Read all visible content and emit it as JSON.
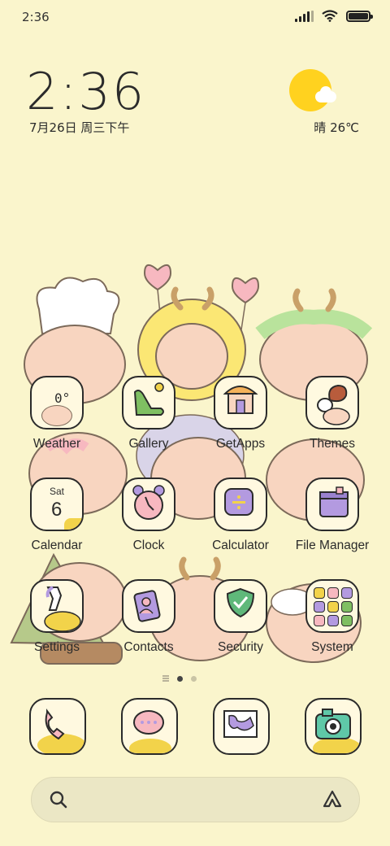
{
  "status_bar": {
    "time": "2:36",
    "signal_icon": "signal-icon",
    "wifi_icon": "wifi-icon",
    "battery_icon": "battery-icon"
  },
  "clock_widget": {
    "time": "2:36",
    "date": "7月26日 周三下午"
  },
  "weather_widget": {
    "condition_icon": "sunny-cloud-icon",
    "text": "晴 26℃"
  },
  "apps": [
    {
      "name": "Weather",
      "icon": "weather-icon",
      "icon_text": "0°"
    },
    {
      "name": "Gallery",
      "icon": "gallery-icon"
    },
    {
      "name": "GetApps",
      "icon": "getapps-icon"
    },
    {
      "name": "Themes",
      "icon": "themes-icon"
    },
    {
      "name": "Calendar",
      "icon": "calendar-icon",
      "icon_text_day": "Sat",
      "icon_text_date": "6"
    },
    {
      "name": "Clock",
      "icon": "clock-icon"
    },
    {
      "name": "Calculator",
      "icon": "calculator-icon"
    },
    {
      "name": "File Manager",
      "icon": "folder-icon"
    },
    {
      "name": "Settings",
      "icon": "settings-icon"
    },
    {
      "name": "Contacts",
      "icon": "contacts-icon"
    },
    {
      "name": "Security",
      "icon": "security-shield-icon"
    },
    {
      "name": "System",
      "icon": "system-folder-icon"
    }
  ],
  "page_indicator": {
    "pages": 2,
    "current": 1
  },
  "dock": [
    {
      "icon": "phone-icon"
    },
    {
      "icon": "messages-icon"
    },
    {
      "icon": "browser-map-icon"
    },
    {
      "icon": "camera-icon"
    }
  ],
  "search_bar": {
    "search_icon": "search-icon",
    "assistant_icon": "assistant-icon"
  },
  "colors": {
    "background": "#faf5cc",
    "sun": "#ffd21f",
    "outline": "#2b2b2b",
    "creature_skin": "#f8d5c0",
    "antler": "#c9a068"
  }
}
